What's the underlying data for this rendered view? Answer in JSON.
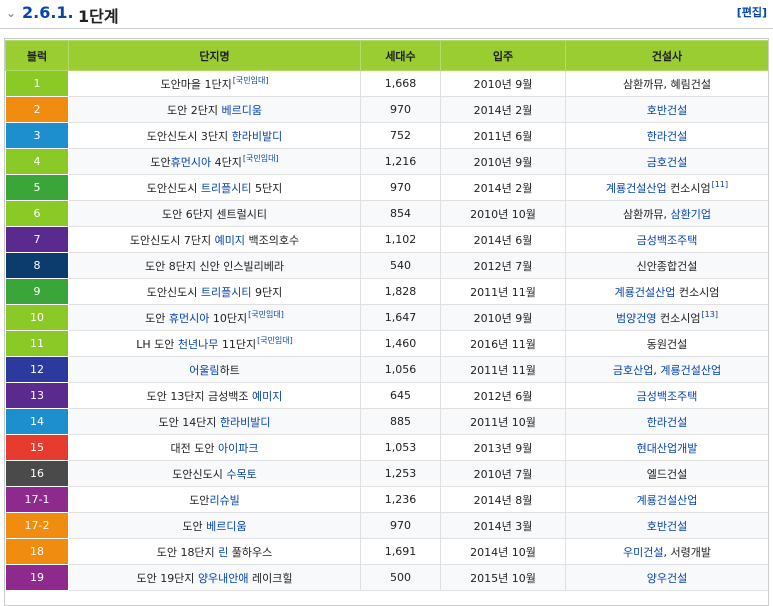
{
  "header": {
    "section_number": "2.6.1.",
    "title": "1단계",
    "edit_label": "[편집]"
  },
  "table": {
    "header_bg": "#9acd32",
    "columns": [
      "블럭",
      "단지명",
      "세대수",
      "입주",
      "건설사"
    ],
    "rows": [
      {
        "block": "1",
        "color": "#8ac926",
        "name": [
          {
            "t": "도안마을 1단지"
          },
          {
            "t": "[국민임대]",
            "sup": true
          }
        ],
        "units": "1,668",
        "move": "2010년 9월",
        "builder": [
          {
            "t": "삼환까뮤, 혜림건설"
          }
        ]
      },
      {
        "block": "2",
        "color": "#f08c10",
        "name": [
          {
            "t": "도안 2단지 "
          },
          {
            "t": "베르디움",
            "link": true
          }
        ],
        "units": "970",
        "move": "2014년 2월",
        "builder": [
          {
            "t": "호반건설",
            "link": true
          }
        ]
      },
      {
        "block": "3",
        "color": "#1e8fce",
        "name": [
          {
            "t": "도안신도시 3단지 "
          },
          {
            "t": "한라비발디",
            "link": true
          }
        ],
        "units": "752",
        "move": "2011년 6월",
        "builder": [
          {
            "t": "한라건설",
            "link": true
          }
        ]
      },
      {
        "block": "4",
        "color": "#8ac926",
        "name": [
          {
            "t": "도안"
          },
          {
            "t": "휴먼시아",
            "link": true
          },
          {
            "t": " 4단지"
          },
          {
            "t": "[국민임대]",
            "sup": true
          }
        ],
        "units": "1,216",
        "move": "2010년 9월",
        "builder": [
          {
            "t": "금호건설",
            "link": true
          }
        ]
      },
      {
        "block": "5",
        "color": "#3aa63a",
        "name": [
          {
            "t": "도안신도시 "
          },
          {
            "t": "트리플시티",
            "link": true
          },
          {
            "t": " 5단지"
          }
        ],
        "units": "970",
        "move": "2014년 2월",
        "builder": [
          {
            "t": "계룡건설산업",
            "link": true
          },
          {
            "t": " 컨소시엄"
          },
          {
            "t": "[11]",
            "sup": true
          }
        ]
      },
      {
        "block": "6",
        "color": "#8ac926",
        "name": [
          {
            "t": "도안 6단지 센트럴시티"
          }
        ],
        "units": "854",
        "move": "2010년 10월",
        "builder": [
          {
            "t": "삼환까뮤, "
          },
          {
            "t": "삼환기업",
            "link": true
          }
        ]
      },
      {
        "block": "7",
        "color": "#5b2a8e",
        "name": [
          {
            "t": "도안신도시 7단지 "
          },
          {
            "t": "예미지",
            "link": true
          },
          {
            "t": " 백조의호수"
          }
        ],
        "units": "1,102",
        "move": "2014년 6월",
        "builder": [
          {
            "t": "금성백조주택",
            "link": true
          }
        ]
      },
      {
        "block": "8",
        "color": "#0c3b6e",
        "name": [
          {
            "t": "도안 8단지 신안 인스빌리베라"
          }
        ],
        "units": "540",
        "move": "2012년 7월",
        "builder": [
          {
            "t": "신안종합건설"
          }
        ]
      },
      {
        "block": "9",
        "color": "#3aa63a",
        "name": [
          {
            "t": "도안신도시 "
          },
          {
            "t": "트리플시티",
            "link": true
          },
          {
            "t": " 9단지"
          }
        ],
        "units": "1,828",
        "move": "2011년 11월",
        "builder": [
          {
            "t": "계룡건설산업",
            "link": true
          },
          {
            "t": " 컨소시엄"
          }
        ]
      },
      {
        "block": "10",
        "color": "#8ac926",
        "name": [
          {
            "t": "도안 "
          },
          {
            "t": "휴먼시아",
            "link": true
          },
          {
            "t": " 10단지"
          },
          {
            "t": "[국민임대]",
            "sup": true
          }
        ],
        "units": "1,647",
        "move": "2010년 9월",
        "builder": [
          {
            "t": "범양건영",
            "link": true
          },
          {
            "t": " 컨소시엄"
          },
          {
            "t": "[13]",
            "sup": true
          }
        ]
      },
      {
        "block": "11",
        "color": "#8ac926",
        "name": [
          {
            "t": "LH 도안 "
          },
          {
            "t": "천년나무",
            "link": true
          },
          {
            "t": " 11단지"
          },
          {
            "t": "[국민임대]",
            "sup": true
          }
        ],
        "units": "1,460",
        "move": "2016년 11월",
        "builder": [
          {
            "t": "동원건설"
          }
        ]
      },
      {
        "block": "12",
        "color": "#2b3a9c",
        "name": [
          {
            "t": "어울림",
            "link": true
          },
          {
            "t": "하트"
          }
        ],
        "units": "1,056",
        "move": "2011년 11월",
        "builder": [
          {
            "t": "금호산업",
            "link": true
          },
          {
            "t": ", "
          },
          {
            "t": "계룡건설산업",
            "link": true
          }
        ]
      },
      {
        "block": "13",
        "color": "#5b2a8e",
        "name": [
          {
            "t": "도안 13단지 금성백조 "
          },
          {
            "t": "예미지",
            "link": true
          }
        ],
        "units": "645",
        "move": "2012년 6월",
        "builder": [
          {
            "t": "금성백조주택",
            "link": true
          }
        ]
      },
      {
        "block": "14",
        "color": "#1e8fce",
        "name": [
          {
            "t": "도안 14단지 "
          },
          {
            "t": "한라비발디",
            "link": true
          }
        ],
        "units": "885",
        "move": "2011년 10월",
        "builder": [
          {
            "t": "한라건설",
            "link": true
          }
        ]
      },
      {
        "block": "15",
        "color": "#e63b2e",
        "name": [
          {
            "t": "대전 도안 "
          },
          {
            "t": "아이파크",
            "link": true
          }
        ],
        "units": "1,053",
        "move": "2013년 9월",
        "builder": [
          {
            "t": "현대산업개발",
            "link": true
          }
        ]
      },
      {
        "block": "16",
        "color": "#4a4a4a",
        "name": [
          {
            "t": "도안신도시 "
          },
          {
            "t": "수목토",
            "link": true
          }
        ],
        "units": "1,253",
        "move": "2010년 7월",
        "builder": [
          {
            "t": "엘드건설"
          }
        ]
      },
      {
        "block": "17-1",
        "color": "#8e2a8e",
        "name": [
          {
            "t": "도안"
          },
          {
            "t": "리슈빌",
            "link": true
          }
        ],
        "units": "1,236",
        "move": "2014년 8월",
        "builder": [
          {
            "t": "계룡건설산업",
            "link": true
          }
        ]
      },
      {
        "block": "17-2",
        "color": "#f08c10",
        "name": [
          {
            "t": "도안 "
          },
          {
            "t": "베르디움",
            "link": true
          }
        ],
        "units": "970",
        "move": "2014년 3월",
        "builder": [
          {
            "t": "호반건설",
            "link": true
          }
        ]
      },
      {
        "block": "18",
        "color": "#f08c10",
        "name": [
          {
            "t": "도안 18단지 "
          },
          {
            "t": "린",
            "link": true
          },
          {
            "t": " 풀하우스"
          }
        ],
        "units": "1,691",
        "move": "2014년 10월",
        "builder": [
          {
            "t": "우미건설",
            "link": true
          },
          {
            "t": ", 서령개발"
          }
        ]
      },
      {
        "block": "19",
        "color": "#8e2a8e",
        "name": [
          {
            "t": "도안 19단지 "
          },
          {
            "t": "양우내안애",
            "link": true
          },
          {
            "t": " 레이크힐"
          }
        ],
        "units": "500",
        "move": "2015년 10월",
        "builder": [
          {
            "t": "양우건설",
            "link": true
          }
        ]
      }
    ]
  }
}
